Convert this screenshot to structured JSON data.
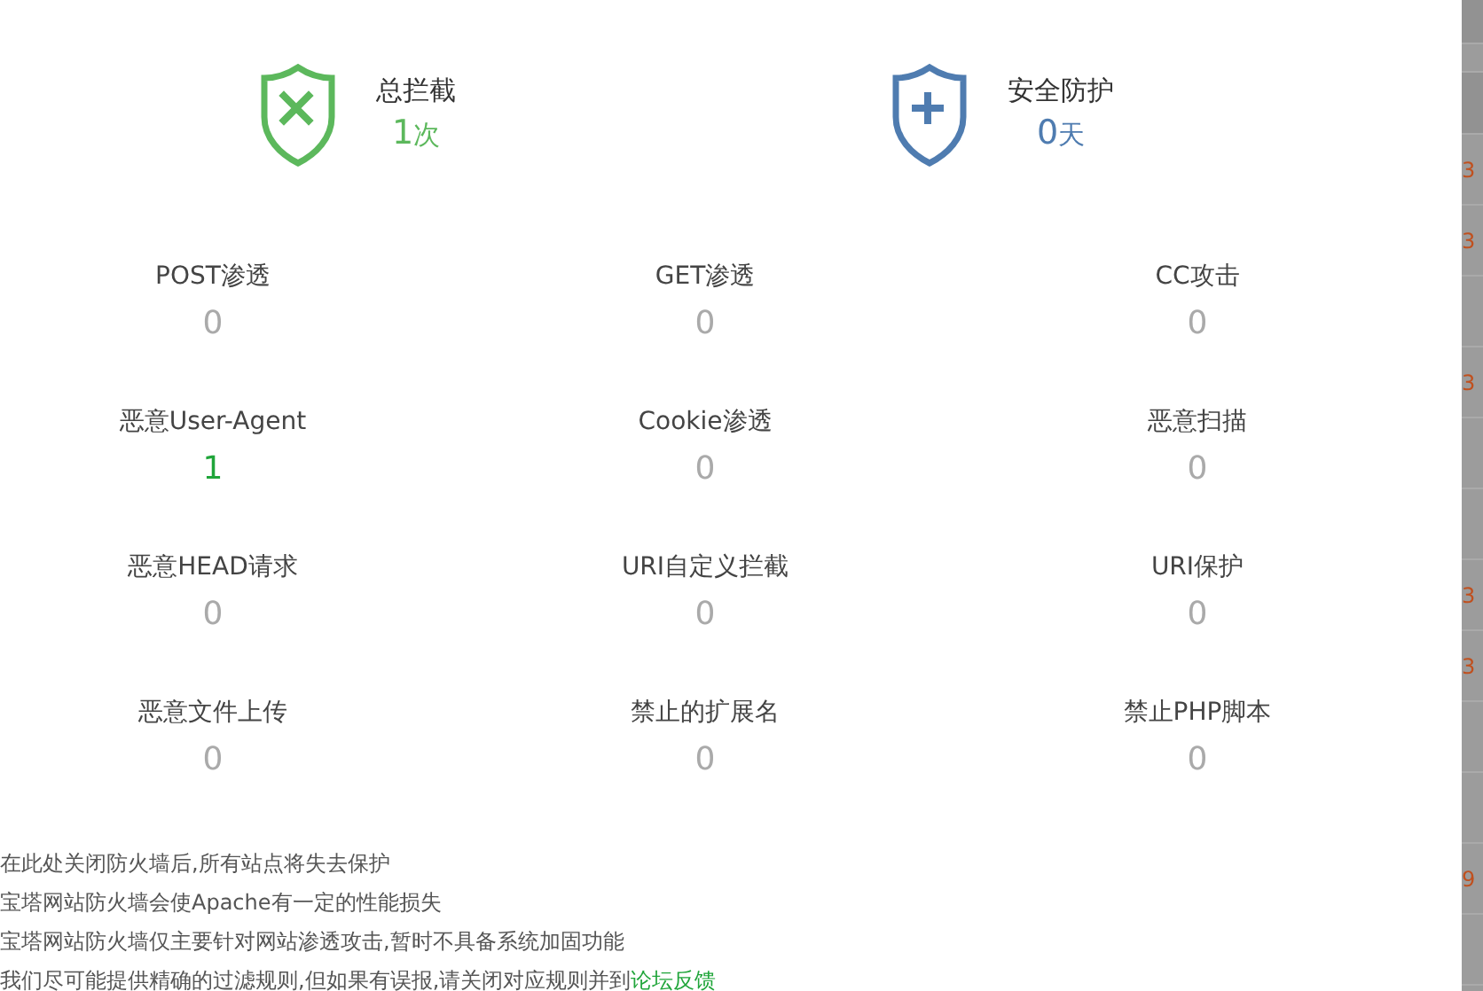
{
  "summary": [
    {
      "kind": "blocked",
      "label": "总拦截",
      "value": "1",
      "unit": "次"
    },
    {
      "kind": "protected",
      "label": "安全防护",
      "value": "0",
      "unit": "天"
    }
  ],
  "stats": [
    {
      "label": "POST渗透",
      "value": "0",
      "alert": false
    },
    {
      "label": "GET渗透",
      "value": "0",
      "alert": false
    },
    {
      "label": "CC攻击",
      "value": "0",
      "alert": false
    },
    {
      "label": "恶意User-Agent",
      "value": "1",
      "alert": true
    },
    {
      "label": "Cookie渗透",
      "value": "0",
      "alert": false
    },
    {
      "label": "恶意扫描",
      "value": "0",
      "alert": false
    },
    {
      "label": "恶意HEAD请求",
      "value": "0",
      "alert": false
    },
    {
      "label": "URI自定义拦截",
      "value": "0",
      "alert": false
    },
    {
      "label": "URI保护",
      "value": "0",
      "alert": false
    },
    {
      "label": "恶意文件上传",
      "value": "0",
      "alert": false
    },
    {
      "label": "禁止的扩展名",
      "value": "0",
      "alert": false
    },
    {
      "label": "禁止PHP脚本",
      "value": "0",
      "alert": false
    }
  ],
  "notes": [
    {
      "text": "在此处关闭防火墙后,所有站点将失去保护"
    },
    {
      "text": "宝塔网站防火墙会使Apache有一定的性能损失"
    },
    {
      "text": "宝塔网站防火墙仅主要针对网站渗透攻击,暂时不具备系统加固功能"
    },
    {
      "text": "我们尽可能提供精确的过滤规则,但如果有误报,请关闭对应规则并到",
      "link": "论坛反馈"
    }
  ],
  "background_column": [
    {
      "kind": "number",
      "text": "3"
    },
    {
      "kind": "number",
      "text": "3"
    },
    {
      "kind": "empty"
    },
    {
      "kind": "number",
      "text": "3"
    },
    {
      "kind": "empty"
    },
    {
      "kind": "empty"
    },
    {
      "kind": "number",
      "text": "3"
    },
    {
      "kind": "number",
      "text": "3"
    },
    {
      "kind": "empty"
    },
    {
      "kind": "empty"
    },
    {
      "kind": "number",
      "text": "9"
    },
    {
      "kind": "empty"
    }
  ]
}
